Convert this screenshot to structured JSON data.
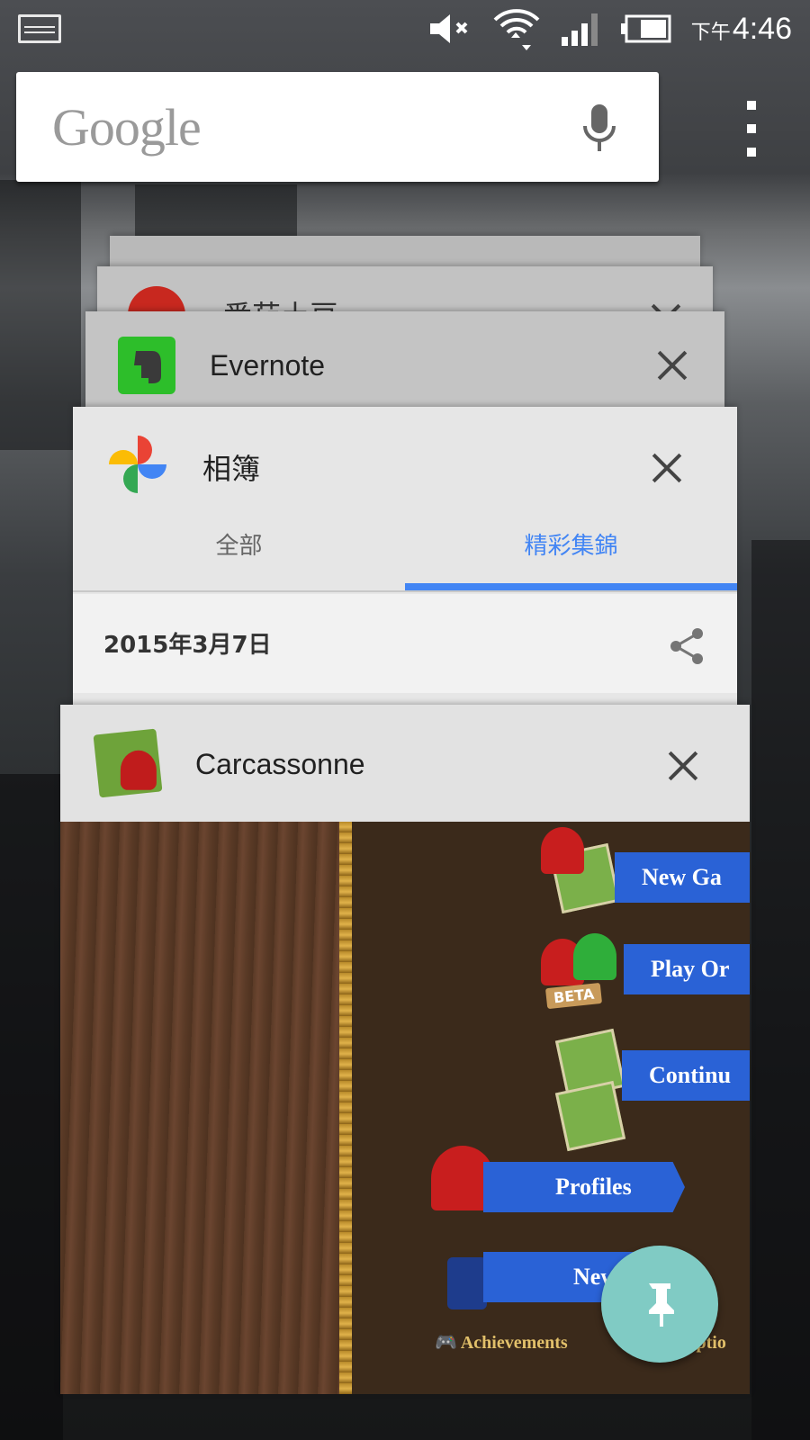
{
  "status_bar": {
    "clock_ampm": "下午",
    "clock_time": "4:46",
    "icons": [
      "screenshot-icon",
      "mute-icon",
      "wifi-icon",
      "signal-icon",
      "battery-icon"
    ]
  },
  "search": {
    "logo_text": "Google",
    "icons": [
      "mic-icon",
      "overflow-menu-icon"
    ]
  },
  "recents": {
    "back_card_partial_title": "番茄土豆",
    "evernote": {
      "title": "Evernote"
    },
    "photos": {
      "title": "相簿",
      "tabs": [
        "全部",
        "精彩集錦"
      ],
      "active_tab": "精彩集錦",
      "date": "2015年3月7日"
    },
    "carcassonne": {
      "title": "Carcassonne",
      "buttons": {
        "new_game": "New Ga",
        "play_online": "Play Or",
        "continue": "Continu",
        "profiles": "Profiles",
        "news": "New",
        "achievements": "Achievements",
        "options": "Optio"
      },
      "beta_label": "BETA"
    }
  },
  "colors": {
    "accent_blue": "#4285f4",
    "fab_teal": "#80cbc4",
    "evernote_green": "#2dbe2a",
    "game_button_blue": "#2a62d6"
  }
}
